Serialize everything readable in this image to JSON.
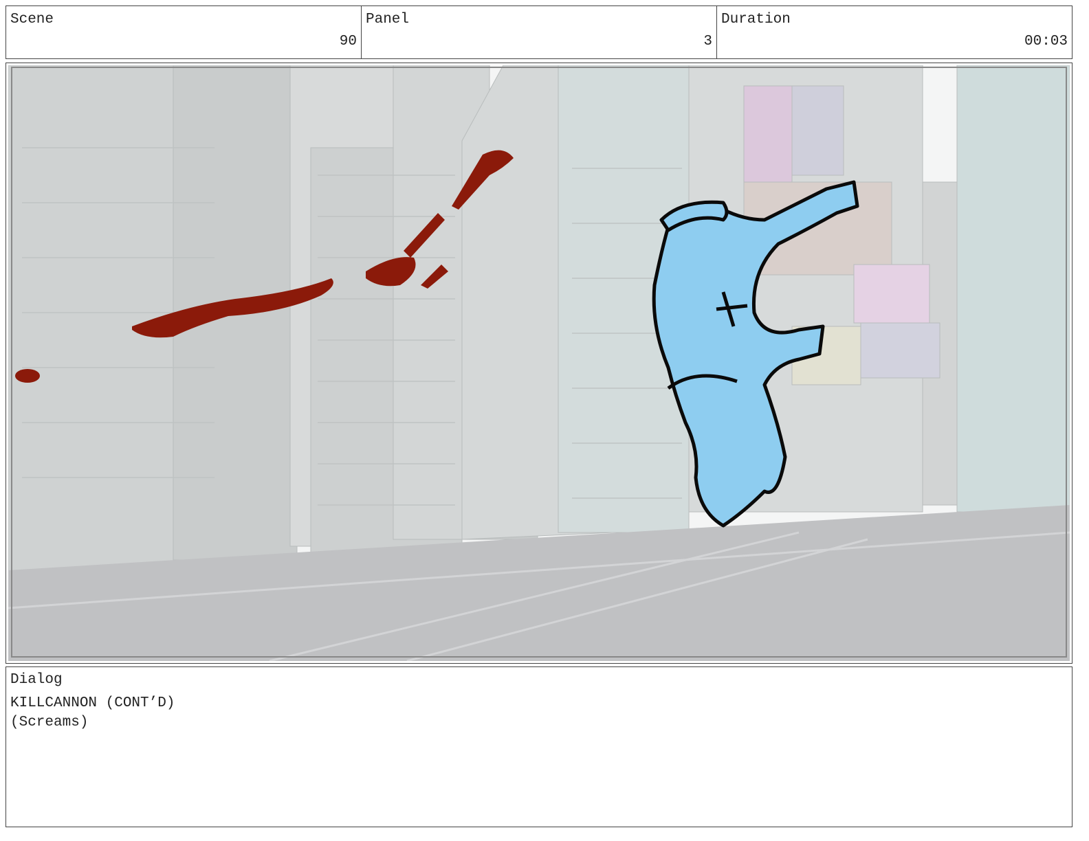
{
  "header": {
    "scene_label": "Scene",
    "scene_value": "90",
    "panel_label": "Panel",
    "panel_value": "3",
    "duration_label": "Duration",
    "duration_value": "00:03"
  },
  "dialog": {
    "label": "Dialog",
    "character": "KILLCANNON (CONT’D)",
    "line": "(Screams)"
  },
  "colors": {
    "figure_fill": "#8ecdf0",
    "streak": "#8b1a0a",
    "buildings": "#d6d8d8"
  }
}
